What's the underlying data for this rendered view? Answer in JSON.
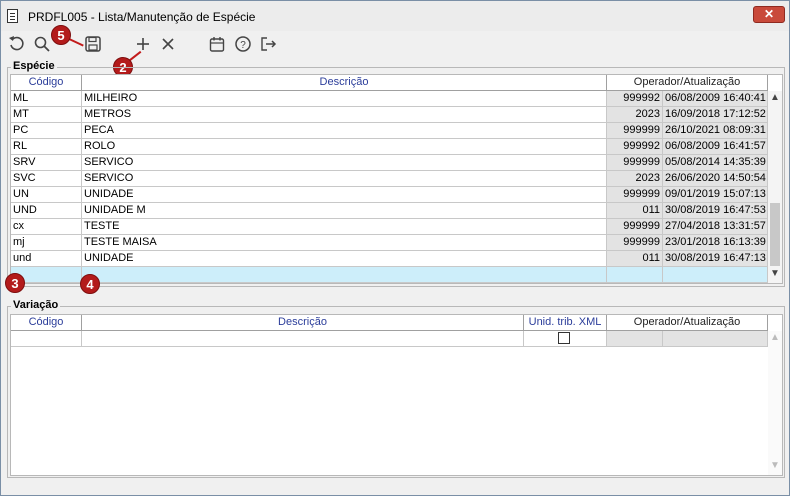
{
  "window": {
    "title": "PRDFL005 - Lista/Manutenção de Espécie",
    "close_label": "✕"
  },
  "toolbar": {
    "items": [
      {
        "name": "undo-icon",
        "glyph": "↺"
      },
      {
        "name": "search-icon",
        "glyph": "🔍"
      },
      {
        "name": "save-icon",
        "glyph": "💾"
      },
      {
        "name": "add-icon",
        "glyph": "+"
      },
      {
        "name": "delete-icon",
        "glyph": "✕"
      },
      {
        "name": "calendar-icon",
        "glyph": "📅"
      },
      {
        "name": "help-icon",
        "glyph": "?"
      },
      {
        "name": "exit-icon",
        "glyph": "⇥"
      }
    ]
  },
  "markers": {
    "m2": "2",
    "m3": "3",
    "m4": "4",
    "m5": "5"
  },
  "especie": {
    "title": "Espécie",
    "headers": {
      "codigo": "Código",
      "descricao": "Descrição",
      "operador": "Operador/Atualização"
    },
    "rows": [
      {
        "codigo": "ML",
        "descricao": "MILHEIRO",
        "operador": "999992",
        "data": "06/08/2009 16:40:41"
      },
      {
        "codigo": "MT",
        "descricao": "METROS",
        "operador": "2023",
        "data": "16/09/2018 17:12:52"
      },
      {
        "codigo": "PC",
        "descricao": "PECA",
        "operador": "999999",
        "data": "26/10/2021 08:09:31"
      },
      {
        "codigo": "RL",
        "descricao": "ROLO",
        "operador": "999992",
        "data": "06/08/2009 16:41:57"
      },
      {
        "codigo": "SRV",
        "descricao": "SERVICO",
        "operador": "999999",
        "data": "05/08/2014 14:35:39"
      },
      {
        "codigo": "SVC",
        "descricao": "SERVICO",
        "operador": "2023",
        "data": "26/06/2020 14:50:54"
      },
      {
        "codigo": "UN",
        "descricao": "UNIDADE",
        "operador": "999999",
        "data": "09/01/2019 15:07:13"
      },
      {
        "codigo": "UND",
        "descricao": "UNIDADE M",
        "operador": "011",
        "data": "30/08/2019 16:47:53"
      },
      {
        "codigo": "cx",
        "descricao": "TESTE",
        "operador": "999999",
        "data": "27/04/2018 13:31:57"
      },
      {
        "codigo": "mj",
        "descricao": "TESTE MAISA",
        "operador": "999999",
        "data": "23/01/2018 16:13:39"
      },
      {
        "codigo": "und",
        "descricao": "UNIDADE",
        "operador": "011",
        "data": "30/08/2019 16:47:13"
      },
      {
        "codigo": "",
        "descricao": "",
        "operador": "",
        "data": ""
      }
    ]
  },
  "variacao": {
    "title": "Variação",
    "headers": {
      "codigo": "Código",
      "descricao": "Descrição",
      "unid": "Unid. trib. XML",
      "operador": "Operador/Atualização"
    }
  }
}
